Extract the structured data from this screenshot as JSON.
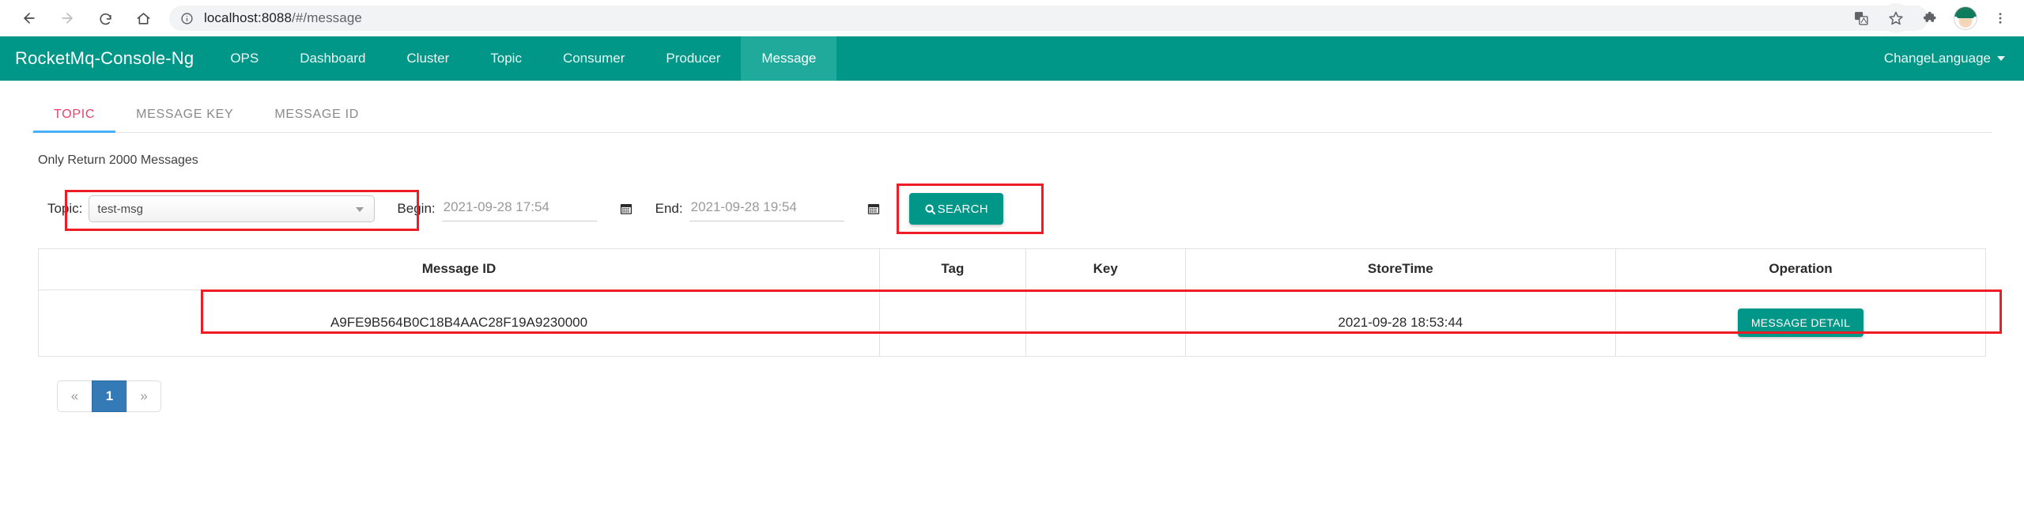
{
  "browser": {
    "back_icon": "arrow-left-icon",
    "forward_icon": "arrow-right-icon",
    "reload_icon": "reload-icon",
    "home_icon": "home-icon",
    "info_icon": "info-circle-icon",
    "url_host": "localhost:8088",
    "url_path": "/#/message",
    "translate_icon": "translate-icon",
    "bookmark_icon": "star-icon",
    "extensions_icon": "puzzle-piece-icon",
    "profile_icon": "avatar-icon",
    "menu_icon": "three-dot-menu-icon"
  },
  "navbar": {
    "brand": "RocketMq-Console-Ng",
    "items": [
      {
        "label": "OPS",
        "active": false
      },
      {
        "label": "Dashboard",
        "active": false
      },
      {
        "label": "Cluster",
        "active": false
      },
      {
        "label": "Topic",
        "active": false
      },
      {
        "label": "Consumer",
        "active": false
      },
      {
        "label": "Producer",
        "active": false
      },
      {
        "label": "Message",
        "active": true
      }
    ],
    "change_language": "ChangeLanguage",
    "bg_color": "#009688",
    "active_bg_color": "#1faa9b"
  },
  "tabs": [
    {
      "label": "TOPIC",
      "active": true
    },
    {
      "label": "MESSAGE KEY",
      "active": false
    },
    {
      "label": "MESSAGE ID",
      "active": false
    }
  ],
  "tab_active_color": "#ef3e68",
  "tab_underline_color": "#48b0f7",
  "note": "Only Return 2000 Messages",
  "search_form": {
    "topic_label": "Topic:",
    "topic_value": "test-msg",
    "begin_label": "Begin:",
    "begin_value": "2021-09-28 17:54",
    "end_label": "End:",
    "end_value": "2021-09-28 19:54",
    "calendar_icon": "calendar-icon",
    "search_button": "SEARCH",
    "search_icon": "magnifier-icon"
  },
  "table": {
    "headers": [
      "Message ID",
      "Tag",
      "Key",
      "StoreTime",
      "Operation"
    ],
    "rows": [
      {
        "message_id": "A9FE9B564B0C18B4AAC28F19A9230000",
        "tag": "",
        "key": "",
        "store_time": "2021-09-28 18:53:44",
        "operation": "MESSAGE DETAIL"
      }
    ]
  },
  "pagination": {
    "prev": "«",
    "pages": [
      "1"
    ],
    "next": "»",
    "active_color": "#337ab7"
  },
  "annotation_color": "#ee1c25"
}
